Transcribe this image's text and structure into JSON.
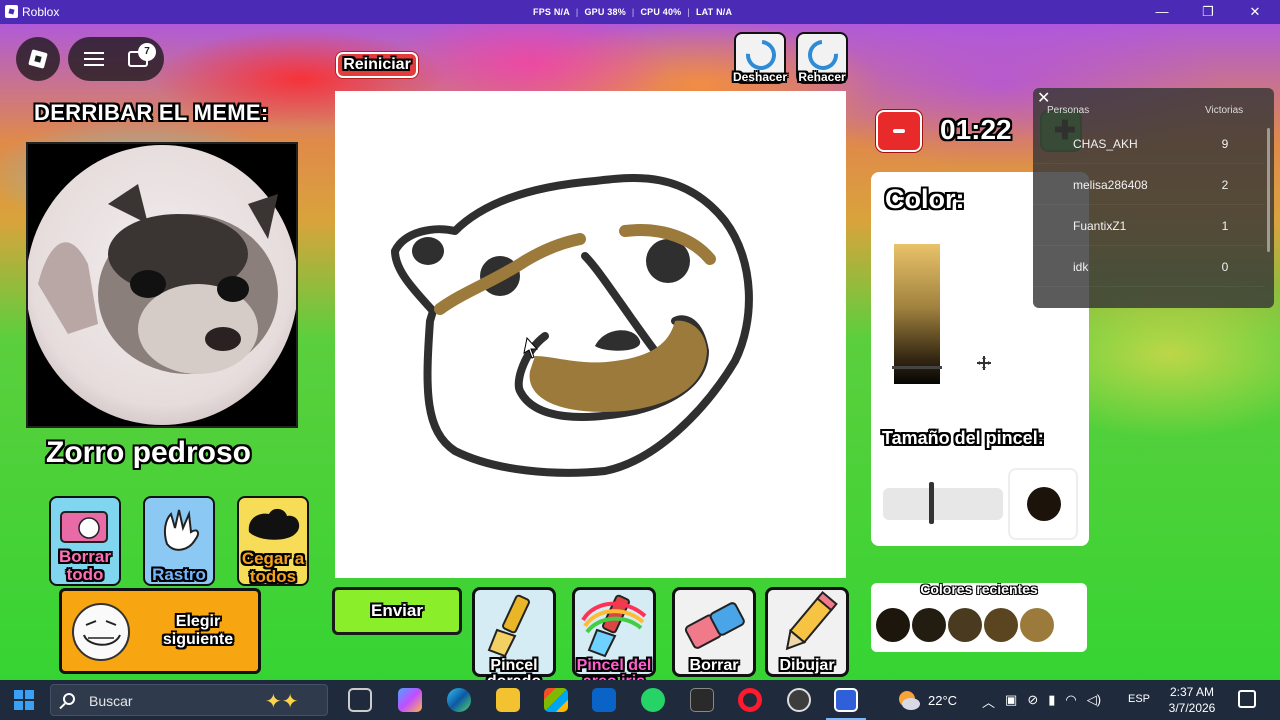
{
  "window": {
    "title": "Roblox",
    "stats": [
      {
        "label": "FPS",
        "value": "N/A"
      },
      {
        "label": "GPU",
        "value": "38%"
      },
      {
        "label": "CPU",
        "value": "40%"
      },
      {
        "label": "LAT",
        "value": "N/A"
      }
    ],
    "controls": {
      "minimize": "—",
      "restore": "❐",
      "close": "✕"
    }
  },
  "hud": {
    "chat_badge": "7"
  },
  "left_panel": {
    "heading": "DERRIBAR EL MEME:",
    "meme_name": "Zorro pedroso",
    "powers": {
      "clear_all": "Borrar todo",
      "trail": "Rastro",
      "blind_all": "Cegar a todos"
    },
    "pick_next": "Elegir siguiente"
  },
  "canvas_area": {
    "reset": "Reiniciar",
    "undo": "Deshacer",
    "redo": "Rehacer",
    "send": "Enviar",
    "tools": {
      "gold_brush": "Pincel dorado",
      "rainbow_brush": "Pincel del arco iris",
      "erase": "Borrar",
      "draw": "Dibujar"
    }
  },
  "right_panel": {
    "timer": "01:22",
    "color_title": "Color:",
    "brush_size_title": "Tamaño del pincel:",
    "recent_colors_title": "Colores recientes",
    "recent_colors": [
      "#1c160d",
      "#231c10",
      "#4a3a1f",
      "#5a4520",
      "#9c7a3c"
    ],
    "current_color": "#1c140a"
  },
  "leaderboard": {
    "col_people": "Personas",
    "col_wins": "Victorias",
    "rows": [
      {
        "name": "CHAS_AKH",
        "wins": "9"
      },
      {
        "name": "melisa286408",
        "wins": "2"
      },
      {
        "name": "FuantixZ1",
        "wins": "1"
      },
      {
        "name": "idk",
        "wins": "0"
      }
    ]
  },
  "taskbar": {
    "search_placeholder": "Buscar",
    "temperature": "22°C",
    "language": "ESP",
    "time": "2:37 AM",
    "date": "3/7/2026"
  }
}
